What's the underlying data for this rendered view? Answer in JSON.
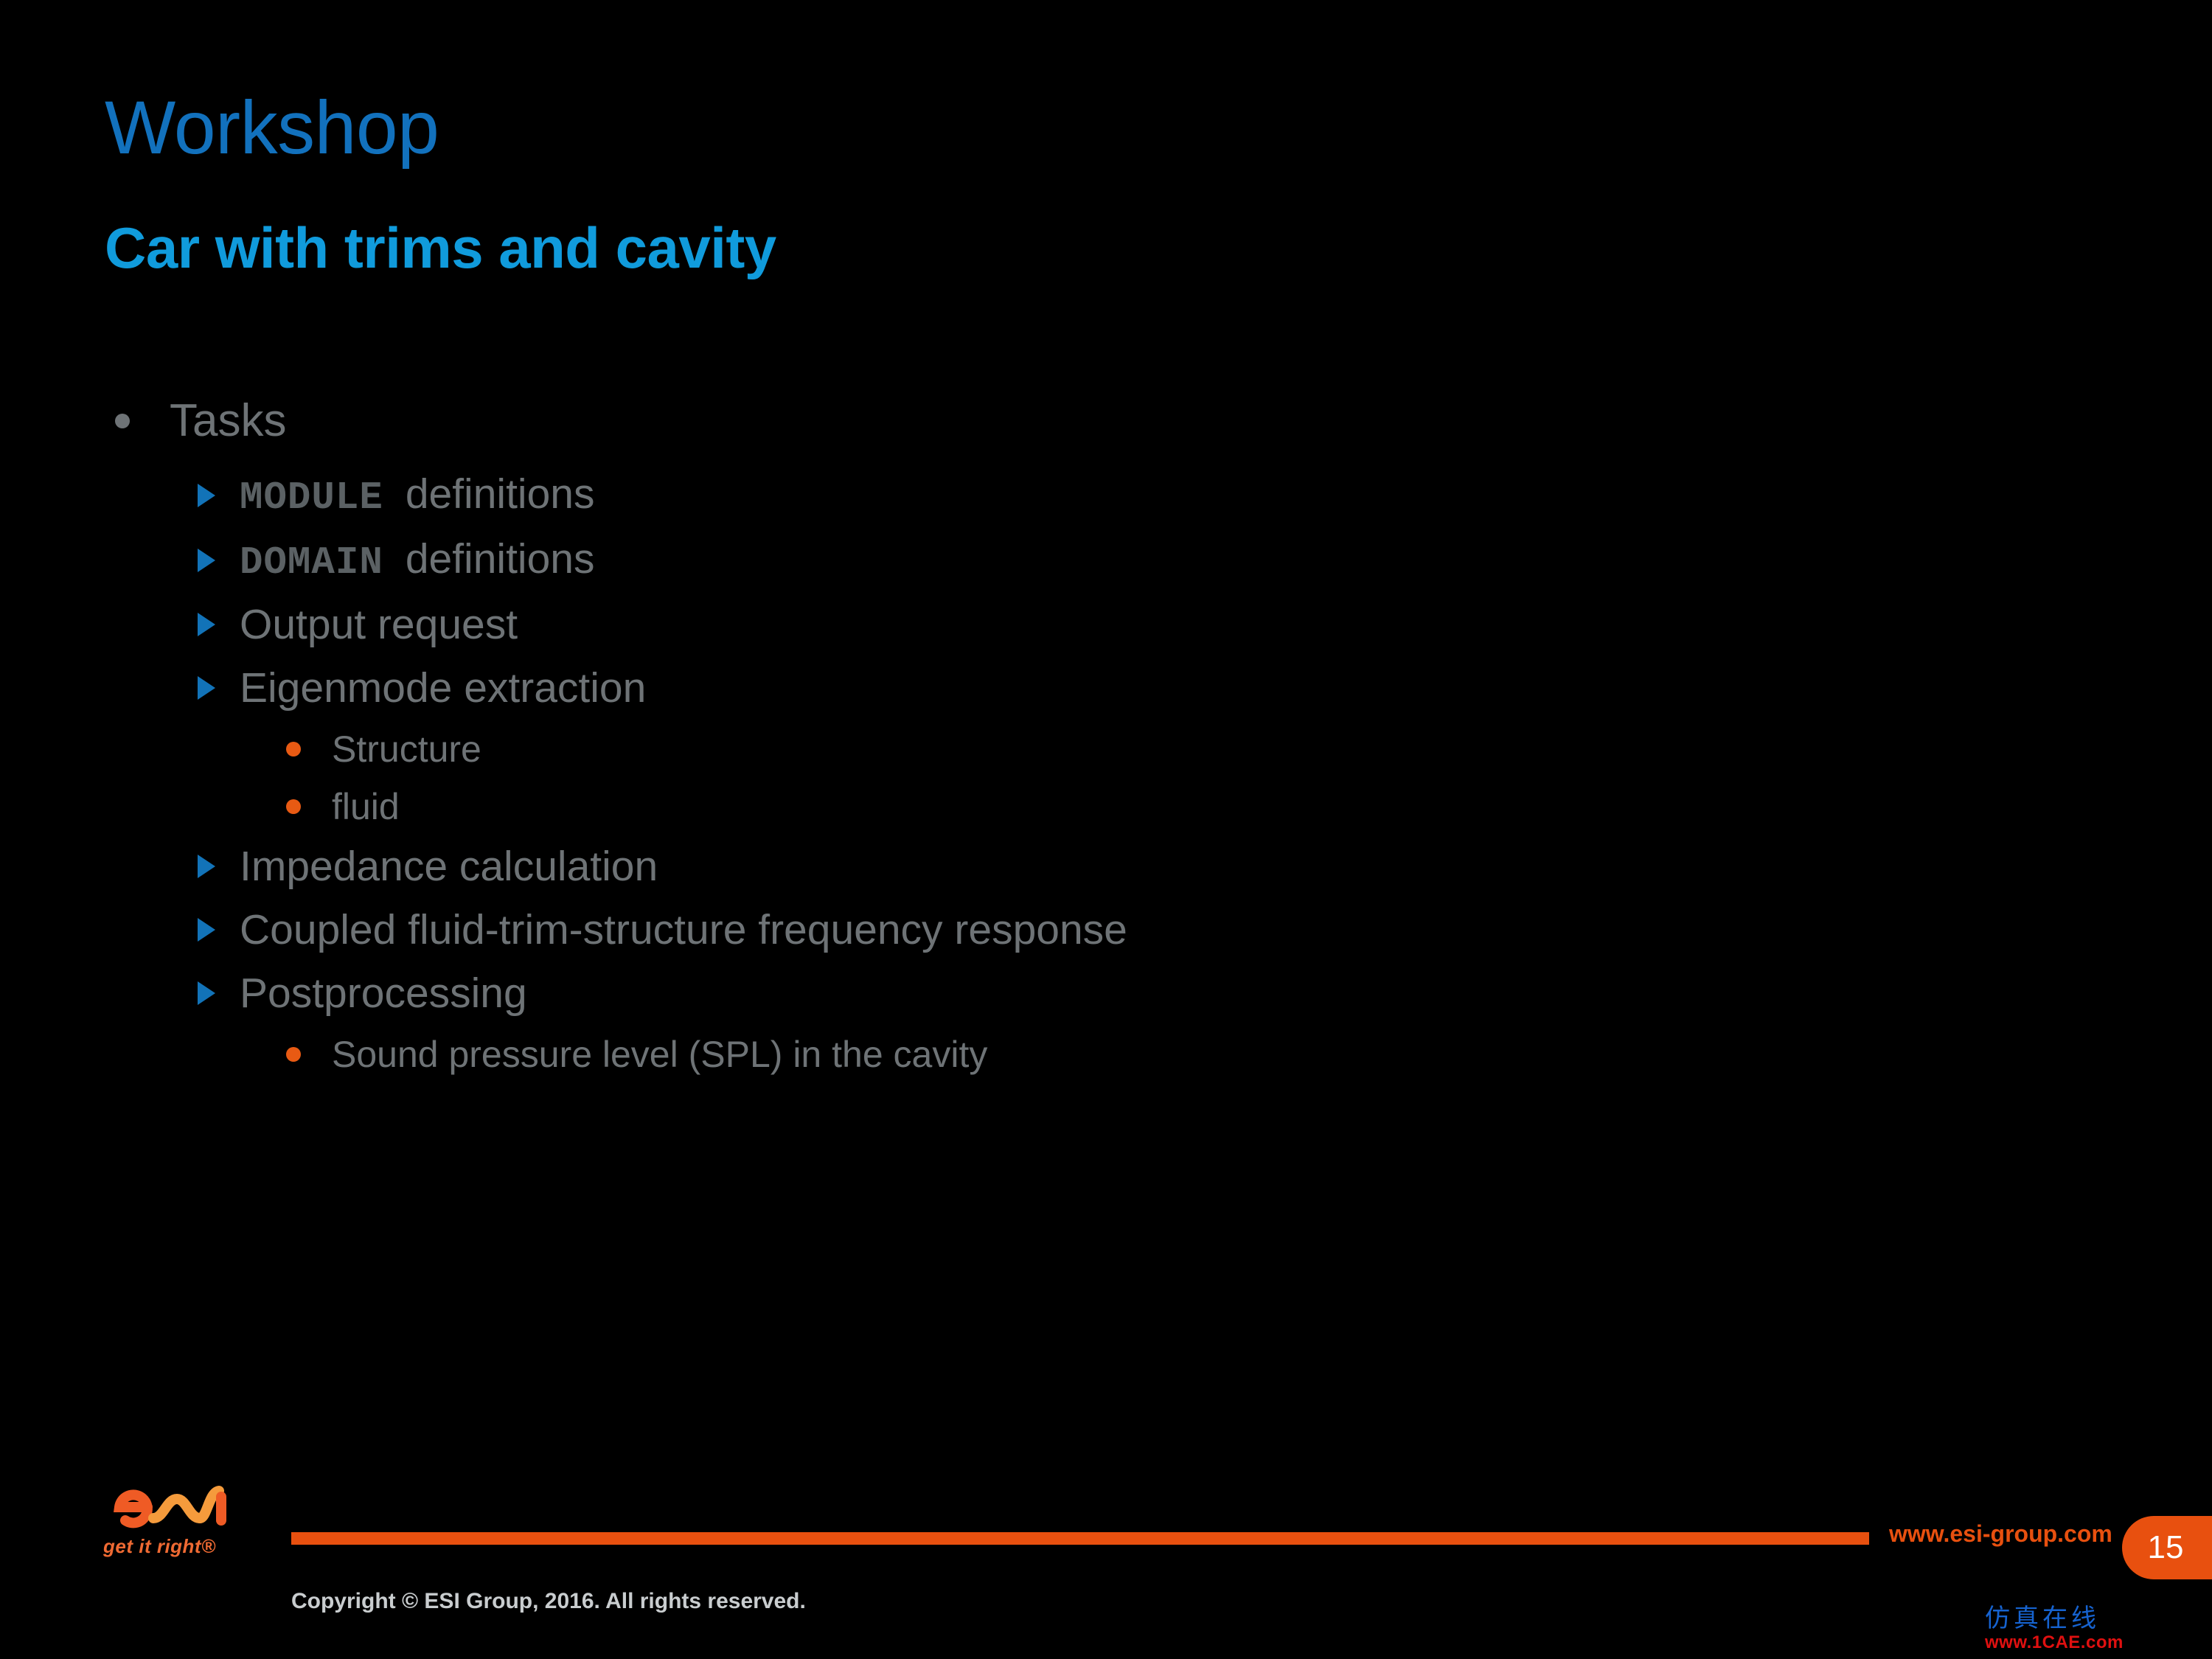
{
  "slide": {
    "background_color": "#000000",
    "title": "Workshop",
    "subtitle": "Car with trims and cavity",
    "title_color": "#1271BD",
    "subtitle_color": "#109BDC",
    "body_text_color": "#6E7376"
  },
  "content": {
    "level1": {
      "label": "Tasks",
      "bullet_icon": "gray-dot-bullet-icon"
    },
    "items": [
      {
        "level": 2,
        "bullet_icon": "blue-triangle-bullet-icon",
        "code": "MODULE",
        "text": "definitions"
      },
      {
        "level": 2,
        "bullet_icon": "blue-triangle-bullet-icon",
        "code": "DOMAIN",
        "text": "definitions"
      },
      {
        "level": 2,
        "bullet_icon": "blue-triangle-bullet-icon",
        "code": "",
        "text": "Output request"
      },
      {
        "level": 2,
        "bullet_icon": "blue-triangle-bullet-icon",
        "code": "",
        "text": "Eigenmode extraction"
      },
      {
        "level": 3,
        "bullet_icon": "orange-dot-bullet-icon",
        "code": "",
        "text": "Structure"
      },
      {
        "level": 3,
        "bullet_icon": "orange-dot-bullet-icon",
        "code": "",
        "text": "fluid"
      },
      {
        "level": 2,
        "bullet_icon": "blue-triangle-bullet-icon",
        "code": "",
        "text": "Impedance calculation"
      },
      {
        "level": 2,
        "bullet_icon": "blue-triangle-bullet-icon",
        "code": "",
        "text": "Coupled fluid-trim-structure frequency response"
      },
      {
        "level": 2,
        "bullet_icon": "blue-triangle-bullet-icon",
        "code": "",
        "text": "Postprocessing"
      },
      {
        "level": 3,
        "bullet_icon": "orange-dot-bullet-icon",
        "code": "",
        "text": "Sound pressure level (SPL) in the cavity"
      }
    ]
  },
  "footer": {
    "url": "www.esi-group.com",
    "page_number": "15",
    "copyright": "Copyright © ESI Group, 2016. All rights reserved.",
    "accent_color": "#E8500F",
    "logo": {
      "name": "esi-logo",
      "tagline": "get it right®",
      "primary_color": "#EF5B25",
      "secondary_color": "#F59B3C"
    }
  },
  "watermark": {
    "chinese": "仿真在线",
    "english": "www.1CAE.com",
    "chinese_color": "#1663D0",
    "english_color": "#E01010"
  }
}
